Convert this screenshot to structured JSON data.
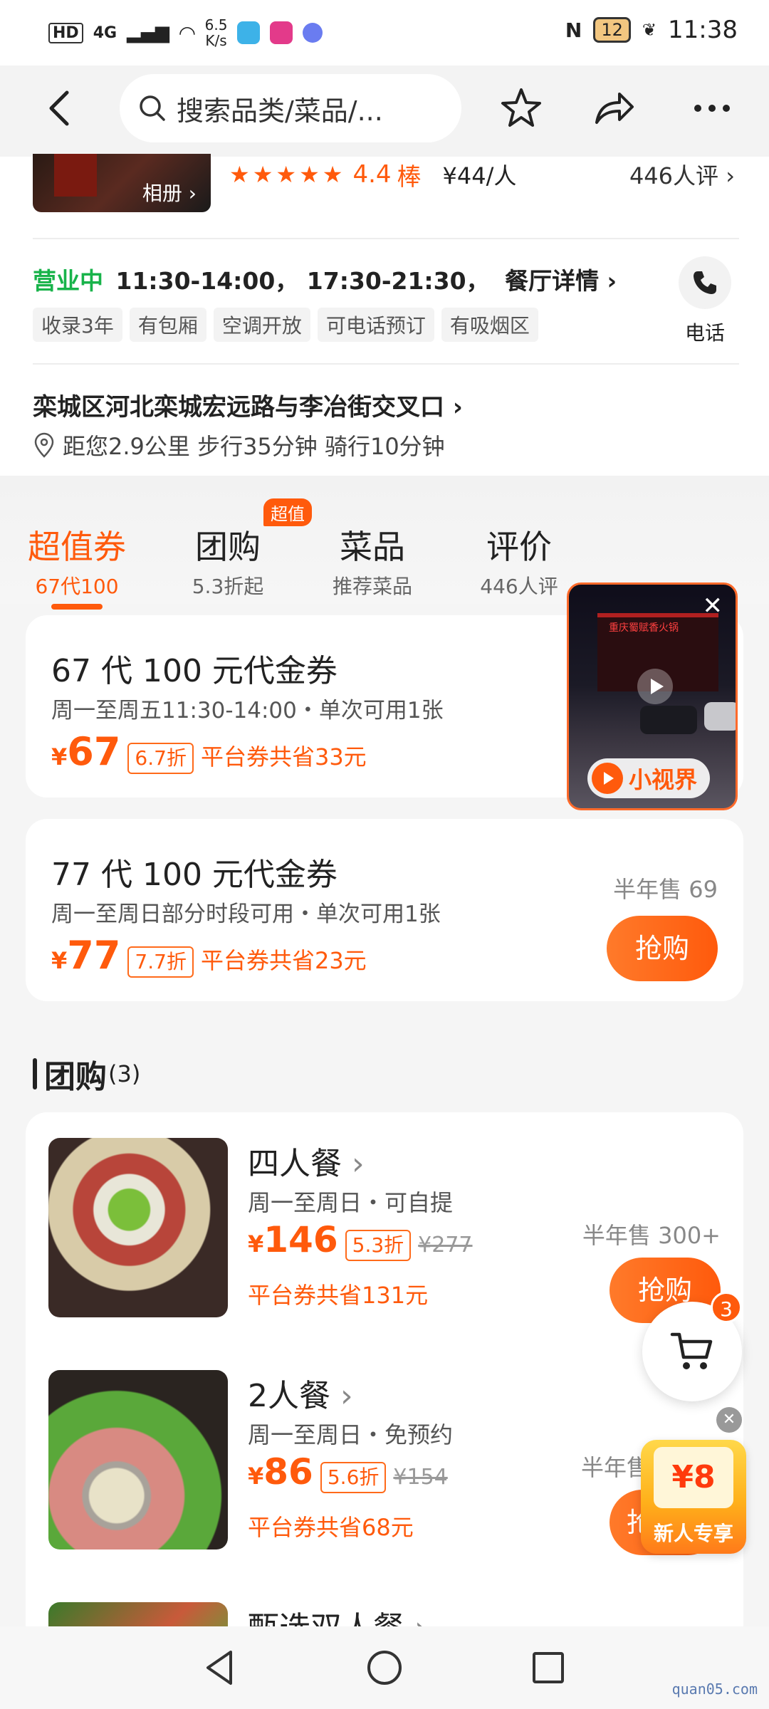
{
  "status": {
    "left_items": [
      "HD",
      "4G",
      "6.5",
      "K/s"
    ],
    "nfc": "N",
    "battery": "12",
    "time": "11:38"
  },
  "search": {
    "placeholder": "搜索品类/菜品/..."
  },
  "header_card": {
    "album": "相册",
    "rating": "4.4",
    "rating_word": "棒",
    "price_per": "¥44/人",
    "reviews": "446人评"
  },
  "hours": {
    "status": "营业中",
    "times": "11:30-14:00， 17:30-21:30，",
    "detail": "餐厅详情",
    "tags": [
      "收录3年",
      "有包厢",
      "空调开放",
      "可电话预订",
      "有吸烟区"
    ],
    "phone_label": "电话"
  },
  "address": {
    "line": "栾城区河北栾城宏远路与李冶街交叉口",
    "distance": "距您2.9公里 步行35分钟 骑行10分钟"
  },
  "tabs": [
    {
      "title": "超值券",
      "sub": "67代100"
    },
    {
      "title": "团购",
      "sub": "5.3折起",
      "badge": "超值"
    },
    {
      "title": "菜品",
      "sub": "推荐菜品"
    },
    {
      "title": "评价",
      "sub": "446人评"
    }
  ],
  "vouchers": [
    {
      "title": "67 代 100 元代金券",
      "desc": "周一至周五11:30-14:00・单次可用1张",
      "yen": "¥",
      "price": "67",
      "discount": "6.7折",
      "save": "平台券共省33元"
    },
    {
      "title": "77 代 100 元代金券",
      "desc": "周一至周日部分时段可用・单次可用1张",
      "yen": "¥",
      "price": "77",
      "discount": "7.7折",
      "save": "平台券共省23元",
      "sold": "半年售 69",
      "buy": "抢购"
    }
  ],
  "video": {
    "label": "小视界",
    "sign": "重庆蜀赋香火锅"
  },
  "group": {
    "title": "团购",
    "count": "(3)",
    "items": [
      {
        "name": "四人餐",
        "desc": "周一至周日・可自提",
        "yen": "¥",
        "price": "146",
        "discount": "5.3折",
        "original": "¥277",
        "save": "平台券共省131元",
        "sold": "半年售 300+",
        "buy": "抢购"
      },
      {
        "name": "2人餐",
        "desc": "周一至周日・免预约",
        "yen": "¥",
        "price": "86",
        "discount": "5.6折",
        "original": "¥154",
        "save": "平台券共省68元",
        "sold": "半年售",
        "buy": "抢"
      },
      {
        "name": "甄选双人餐"
      }
    ]
  },
  "cart": {
    "count": "3"
  },
  "promo": {
    "amount": "¥8",
    "label": "新人专享"
  },
  "watermark": "quan05.com"
}
